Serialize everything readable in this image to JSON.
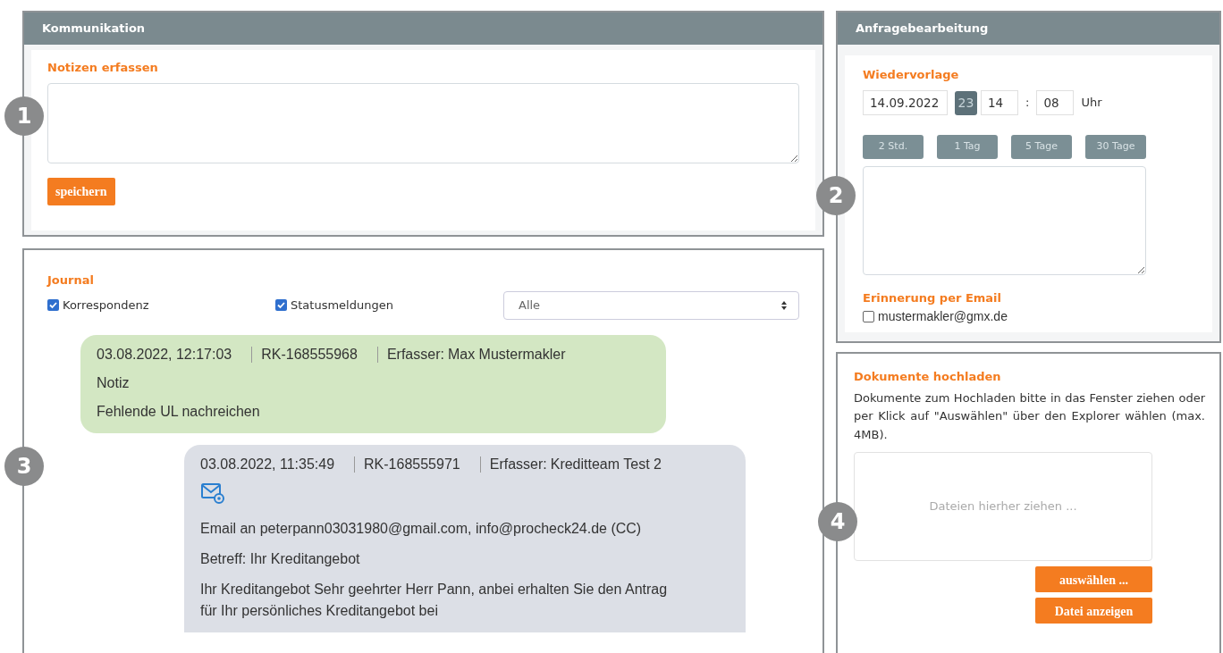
{
  "communication": {
    "title": "Kommunikation",
    "notes_label": "Notizen erfassen",
    "save_button": "speichern"
  },
  "journal": {
    "title": "Journal",
    "filters": [
      {
        "label": "Korrespondenz",
        "checked": true
      },
      {
        "label": "Statusmeldungen",
        "checked": true
      }
    ],
    "select": {
      "value": "Alle"
    },
    "entries": [
      {
        "kind": "note",
        "timestamp": "03.08.2022, 12:17:03",
        "reference": "RK-168555968",
        "author_label": "Erfasser:",
        "author": "Max Mustermakler",
        "lines": [
          "Notiz",
          "Fehlende UL nachreichen"
        ]
      },
      {
        "kind": "email",
        "timestamp": "03.08.2022, 11:35:49",
        "reference": "RK-168555971",
        "author_label": "Erfasser:",
        "author": "Kreditteam Test 2",
        "lines": [
          "Email an peterpann03031980@gmail.com, info@procheck24.de (CC)",
          "Betreff: Ihr Kreditangebot",
          "Ihr Kreditangebot  Sehr geehrter Herr Pann, anbei erhalten Sie den Antrag für Ihr persönliches Kreditangebot bei"
        ]
      }
    ]
  },
  "request": {
    "title": "Anfragebearbeitung",
    "section": "Wiedervorlage",
    "date": "14.09.2022",
    "calendar_day": "23",
    "hour": "14",
    "separator": ":",
    "minute": "08",
    "unit": "Uhr",
    "quick_buttons": [
      "2 Std.",
      "1 Tag",
      "5 Tage",
      "30 Tage"
    ],
    "reminder_label": "Erinnerung per Email",
    "reminder": {
      "label": "mustermakler@gmx.de",
      "checked": false
    }
  },
  "upload": {
    "title": "Dokumente hochladen",
    "text": "Dokumente zum Hochladen bitte in das Fenster ziehen oder per Klick auf \"Auswählen\" über den Explorer wählen (max. 4MB).",
    "dropzone": "Dateien hierher ziehen ...",
    "buttons": [
      "auswählen ...",
      "Datei anzeigen"
    ]
  },
  "callouts": [
    "1",
    "2",
    "3",
    "4"
  ]
}
